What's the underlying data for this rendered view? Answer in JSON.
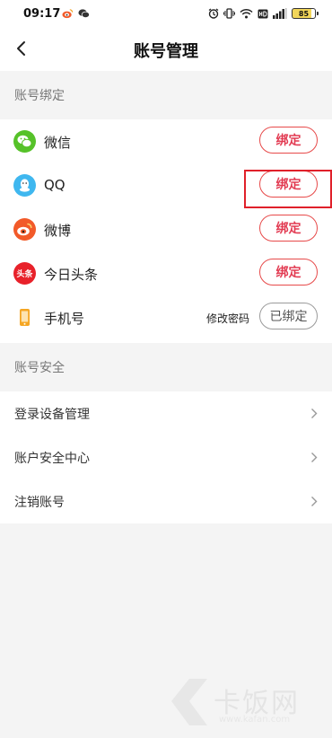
{
  "status_bar": {
    "time": "09:17",
    "battery": "85",
    "app_icons": [
      "weibo-icon",
      "wechat-icon"
    ],
    "system_icons": [
      "alarm-icon",
      "vibrate-icon",
      "wifi-icon",
      "hd-icon",
      "signal-icon",
      "battery-icon"
    ]
  },
  "nav": {
    "title": "账号管理",
    "back_icon": "chevron-left-icon"
  },
  "binding": {
    "header": "账号绑定",
    "items": [
      {
        "name": "微信",
        "icon": "wechat-icon",
        "icon_color": "#56c229",
        "action": "绑定",
        "bound": false
      },
      {
        "name": "QQ",
        "icon": "qq-icon",
        "icon_color": "#3fb7ef",
        "action": "绑定",
        "bound": false,
        "highlighted": true
      },
      {
        "name": "微博",
        "icon": "weibo-icon",
        "icon_color": "#f25a29",
        "action": "绑定",
        "bound": false
      },
      {
        "name": "今日头条",
        "icon": "toutiao-icon",
        "icon_color": "#e8212a",
        "icon_text": "头条",
        "action": "绑定",
        "bound": false
      },
      {
        "name": "手机号",
        "icon": "phone-icon",
        "icon_color": "#f5a623",
        "action": "已绑定",
        "bound": true,
        "link": "修改密码"
      }
    ]
  },
  "security": {
    "header": "账号安全",
    "items": [
      {
        "label": "登录设备管理"
      },
      {
        "label": "账户安全中心"
      },
      {
        "label": "注销账号"
      }
    ]
  },
  "watermark": {
    "text": "卡饭网",
    "url": "www.kafan.com"
  },
  "colors": {
    "accent": "#e23b52",
    "highlight": "#e0202a",
    "background": "#f4f4f4"
  }
}
